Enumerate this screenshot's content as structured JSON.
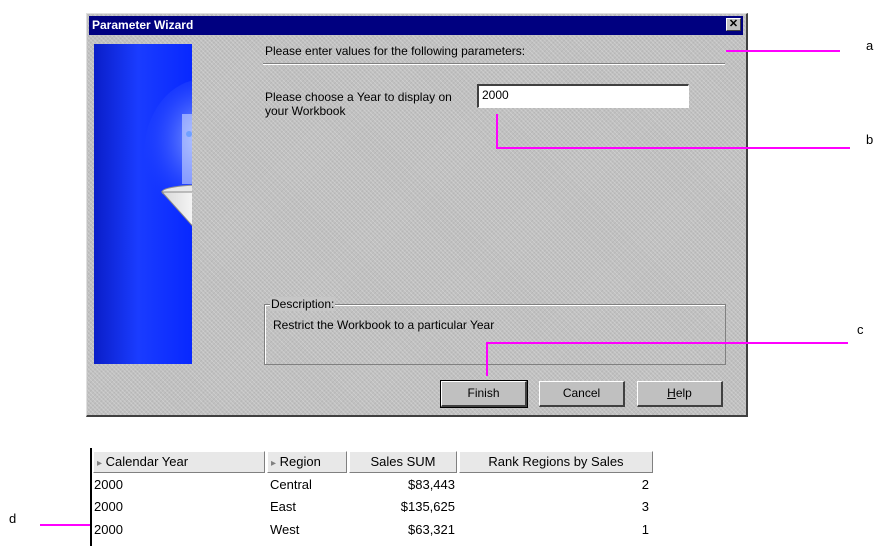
{
  "dialog": {
    "title": "Parameter Wizard",
    "close_label": "✕",
    "heading": "Please enter values for the following parameters:",
    "prompt": "Please choose a Year to display on your Workbook",
    "year_value": "2000",
    "description_label": "Description:",
    "description_text": "Restrict the Workbook to a particular Year",
    "buttons": {
      "finish": "Finish",
      "cancel": "Cancel",
      "help": "Help"
    }
  },
  "callouts": {
    "a": "a",
    "b": "b",
    "c": "c",
    "d": "d"
  },
  "table": {
    "headers": [
      "Calendar Year",
      "Region",
      "Sales SUM",
      "Rank Regions by Sales"
    ],
    "rows": [
      [
        "2000",
        "Central",
        "$83,443",
        "2"
      ],
      [
        "2000",
        "East",
        "$135,625",
        "3"
      ],
      [
        "2000",
        "West",
        "$63,321",
        "1"
      ]
    ]
  },
  "colors": {
    "titlebar": "#000080",
    "callout_line": "#ff00ff",
    "side_image": "#1a3cff"
  },
  "icons": [
    "close-icon",
    "funnel-illustration",
    "column-expand-icon"
  ]
}
